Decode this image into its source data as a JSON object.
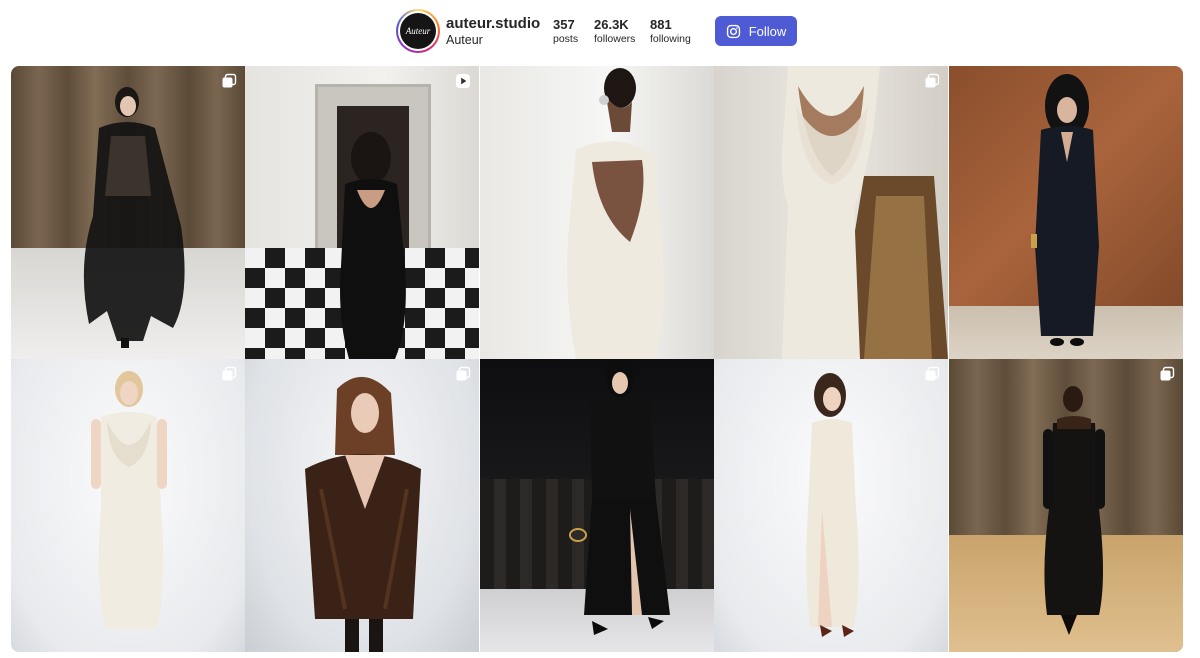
{
  "profile": {
    "avatar_text": "Auteur",
    "username": "auteur.studio",
    "full_name": "Auteur",
    "stats": [
      {
        "value": "357",
        "label": "posts"
      },
      {
        "value": "26.3K",
        "label": "followers"
      },
      {
        "value": "881",
        "label": "following"
      }
    ],
    "follow_label": "Follow",
    "follow_icon": "instagram-icon",
    "accent_color": "#4f5bd5"
  },
  "posts": [
    {
      "badge": "carousel-icon"
    },
    {
      "badge": "video-icon"
    },
    {
      "badge": ""
    },
    {
      "badge": "carousel-icon"
    },
    {
      "badge": ""
    },
    {
      "badge": "carousel-icon"
    },
    {
      "badge": "carousel-icon"
    },
    {
      "badge": ""
    },
    {
      "badge": "carousel-icon"
    },
    {
      "badge": "carousel-icon"
    }
  ]
}
